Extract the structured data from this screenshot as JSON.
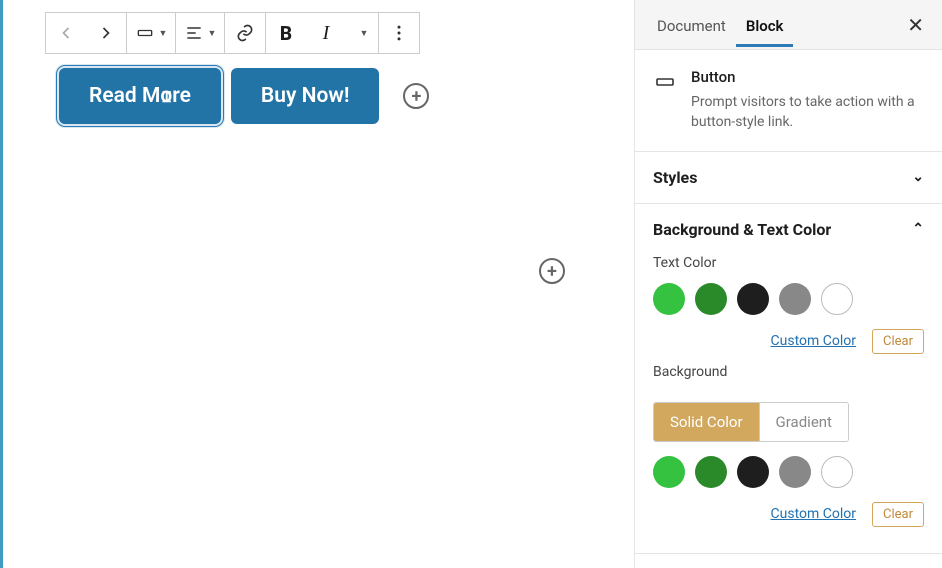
{
  "editor": {
    "buttons": [
      {
        "label_pre": "Read M",
        "label_post": "re",
        "selected": true
      },
      {
        "label": "Buy Now!",
        "selected": false
      }
    ]
  },
  "sidebar": {
    "tabs": {
      "document": "Document",
      "block": "Block",
      "active": "block"
    },
    "block": {
      "title": "Button",
      "description": "Prompt visitors to take action with a button-style link."
    },
    "styles_panel": {
      "title": "Styles"
    },
    "bg_text_panel": {
      "title": "Background & Text Color",
      "text_color_label": "Text Color",
      "background_label": "Background",
      "custom_color": "Custom Color",
      "clear": "Clear",
      "segmented": {
        "solid": "Solid Color",
        "gradient": "Gradient",
        "active": "solid"
      },
      "swatches": [
        "#34c240",
        "#2a8a2a",
        "#1e1e1e",
        "#888888",
        "#ffffff"
      ]
    }
  }
}
